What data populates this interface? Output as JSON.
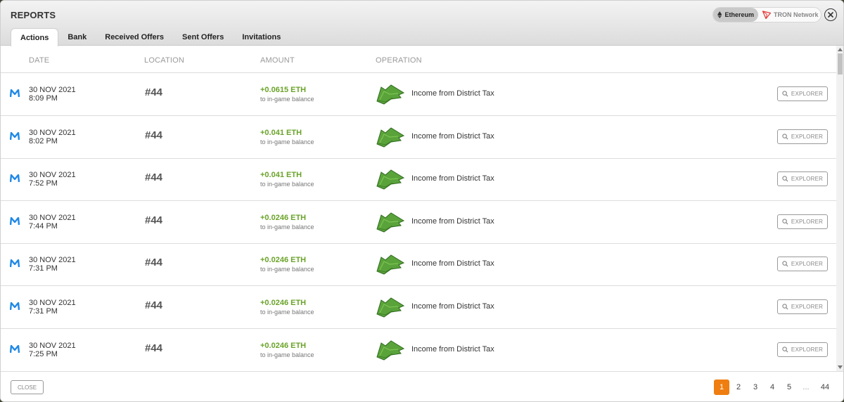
{
  "app": {
    "title": "REPORTS"
  },
  "network": {
    "options": [
      {
        "label": "Ethereum",
        "active": true,
        "icon": "ethereum-icon"
      },
      {
        "label": "TRON Network",
        "active": false,
        "icon": "tron-icon"
      }
    ]
  },
  "tabs": [
    {
      "label": "Actions",
      "active": true
    },
    {
      "label": "Bank",
      "active": false
    },
    {
      "label": "Received Offers",
      "active": false
    },
    {
      "label": "Sent Offers",
      "active": false
    },
    {
      "label": "Invitations",
      "active": false
    }
  ],
  "table": {
    "columns": [
      "DATE",
      "LOCATION",
      "AMOUNT",
      "OPERATION"
    ],
    "rows": [
      {
        "date": "30 NOV 2021",
        "time": "8:09 PM",
        "location": "#44",
        "amount": "+0.0615 ETH",
        "amount_note": "to in-game balance",
        "operation": "Income from District Tax",
        "action": "EXPLORER"
      },
      {
        "date": "30 NOV 2021",
        "time": "8:02 PM",
        "location": "#44",
        "amount": "+0.041 ETH",
        "amount_note": "to in-game balance",
        "operation": "Income from District Tax",
        "action": "EXPLORER"
      },
      {
        "date": "30 NOV 2021",
        "time": "7:52 PM",
        "location": "#44",
        "amount": "+0.041 ETH",
        "amount_note": "to in-game balance",
        "operation": "Income from District Tax",
        "action": "EXPLORER"
      },
      {
        "date": "30 NOV 2021",
        "time": "7:44 PM",
        "location": "#44",
        "amount": "+0.0246 ETH",
        "amount_note": "to in-game balance",
        "operation": "Income from District Tax",
        "action": "EXPLORER"
      },
      {
        "date": "30 NOV 2021",
        "time": "7:31 PM",
        "location": "#44",
        "amount": "+0.0246 ETH",
        "amount_note": "to in-game balance",
        "operation": "Income from District Tax",
        "action": "EXPLORER"
      },
      {
        "date": "30 NOV 2021",
        "time": "7:31 PM",
        "location": "#44",
        "amount": "+0.0246 ETH",
        "amount_note": "to in-game balance",
        "operation": "Income from District Tax",
        "action": "EXPLORER"
      },
      {
        "date": "30 NOV 2021",
        "time": "7:25 PM",
        "location": "#44",
        "amount": "+0.0246 ETH",
        "amount_note": "to in-game balance",
        "operation": "Income from District Tax",
        "action": "EXPLORER"
      }
    ]
  },
  "footer": {
    "close_label": "CLOSE",
    "pages": [
      "1",
      "2",
      "3",
      "4",
      "5",
      "...",
      "44"
    ],
    "current_page": "1"
  },
  "colors": {
    "accent": "#ef7d10",
    "amount_positive": "#6aa329",
    "wallet_icon": "#1e88e5"
  },
  "icons": {
    "row_marker": "metamask-m-icon",
    "operation": "district-land-icon",
    "explorer": "search-icon",
    "close": "close-icon"
  }
}
